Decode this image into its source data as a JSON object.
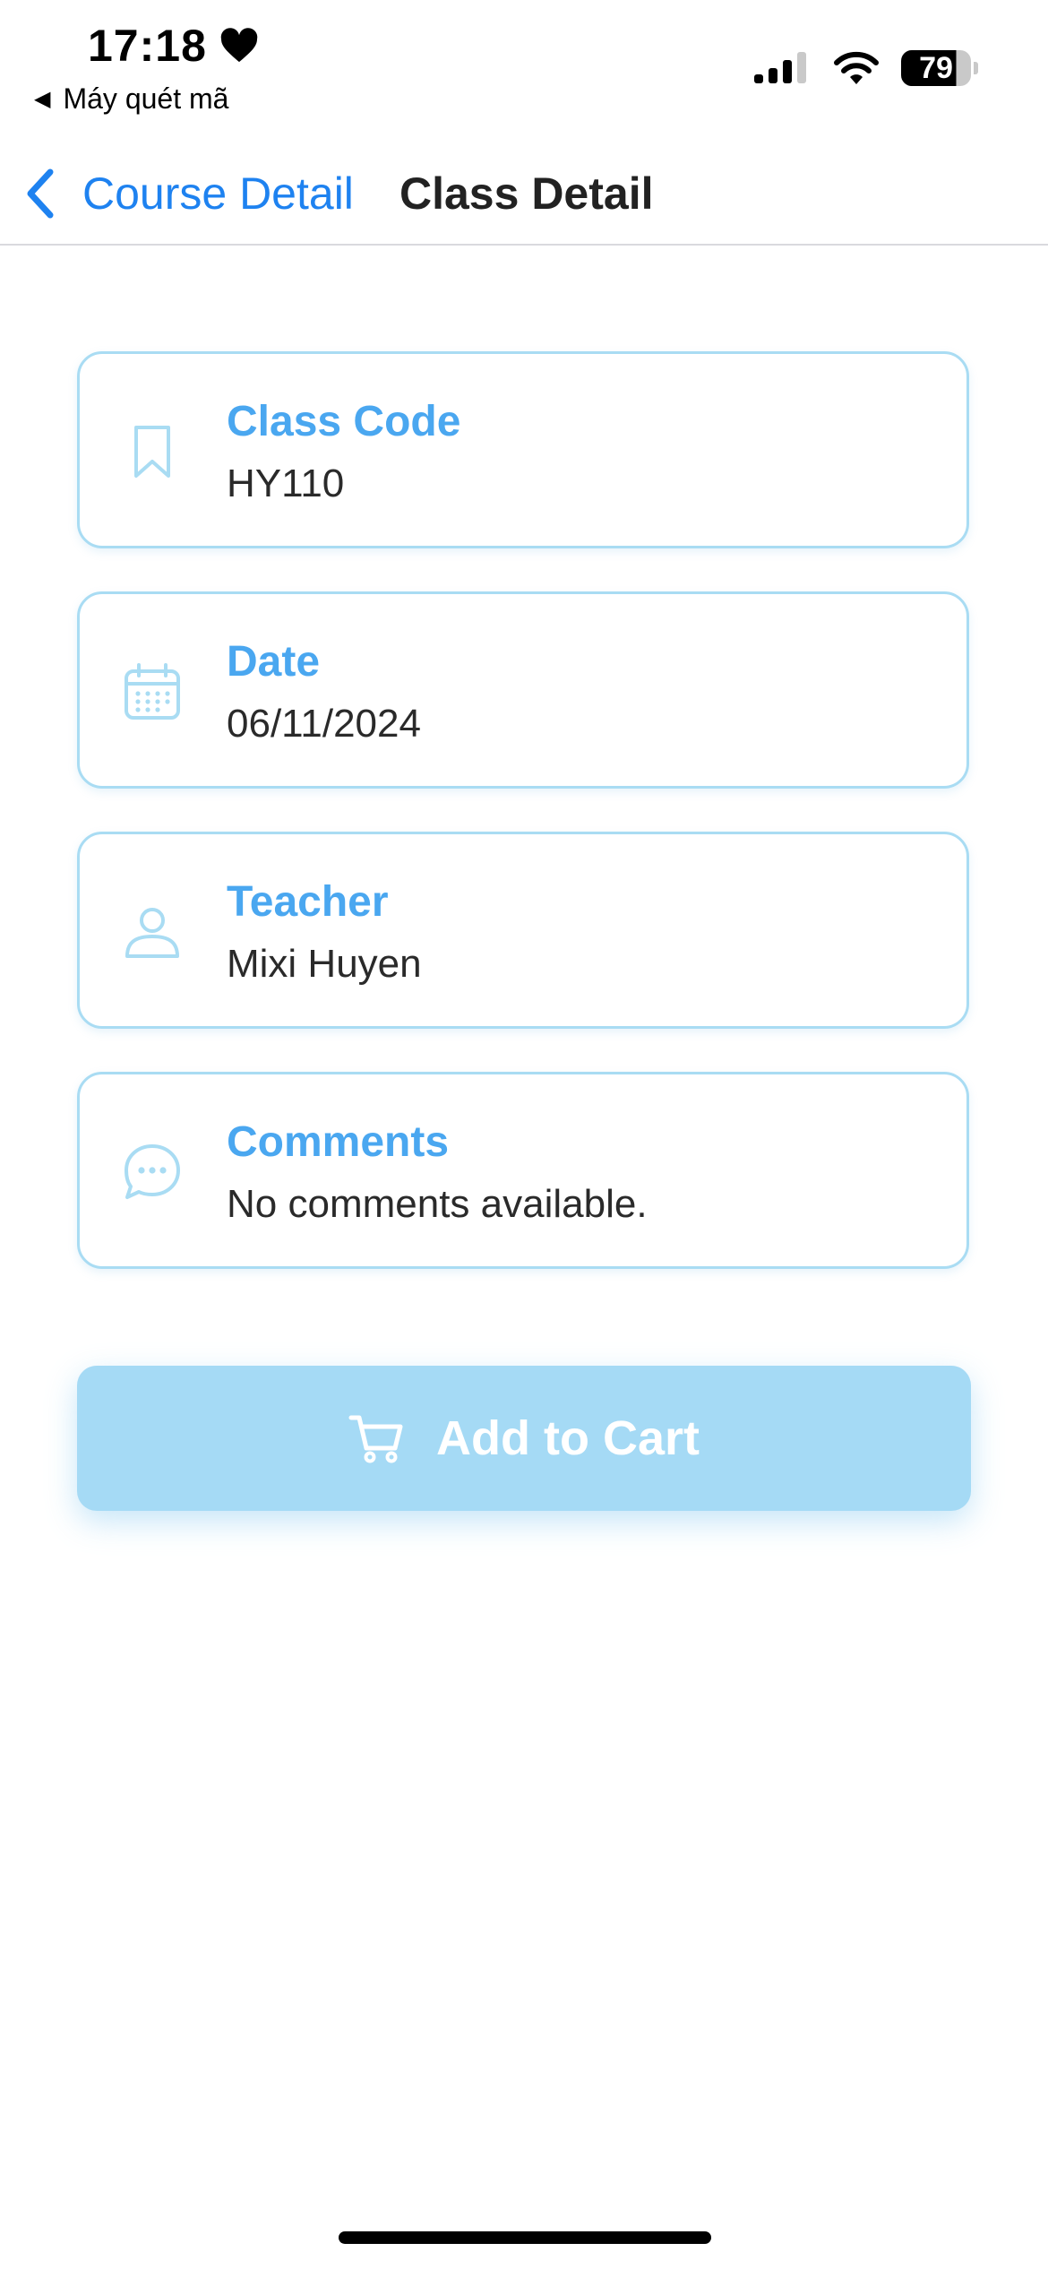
{
  "status_bar": {
    "time": "17:18",
    "back_app_label": "Máy quét mã",
    "battery_level": "79",
    "icons": [
      "heart-icon",
      "signal-icon",
      "wifi-icon",
      "battery-icon"
    ]
  },
  "navbar": {
    "back_label": "Course Detail",
    "title": "Class Detail"
  },
  "details": [
    {
      "icon": "bookmark-icon",
      "label": "Class Code",
      "value": "HY110"
    },
    {
      "icon": "calendar-icon",
      "label": "Date",
      "value": "06/11/2024"
    },
    {
      "icon": "person-icon",
      "label": "Teacher",
      "value": "Mixi Huyen"
    },
    {
      "icon": "chat-bubble-icon",
      "label": "Comments",
      "value": "No comments available."
    }
  ],
  "cart_button": {
    "label": "Add to Cart",
    "icon": "cart-icon"
  },
  "colors": {
    "accent_blue": "#1e82f0",
    "label_blue": "#4aa7f0",
    "card_border": "#a9dcf3",
    "button_bg": "#a5daf5"
  }
}
